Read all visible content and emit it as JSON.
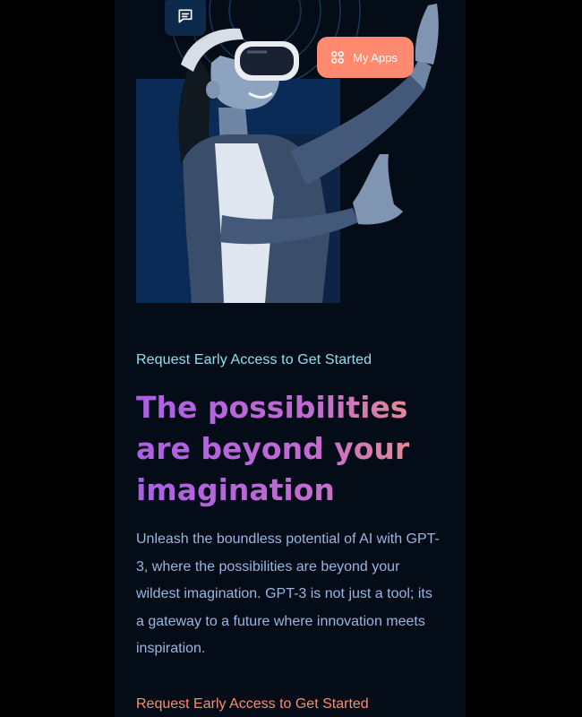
{
  "hero": {
    "chat_icon": "chat-icon",
    "apps_button": {
      "label": "My Apps",
      "icon": "grid-icon"
    }
  },
  "content": {
    "eyebrow": "Request Early Access to Get Started",
    "headline": "The possibilities are beyond your imagination",
    "description": "Unleash the boundless potential of AI with GPT-3, where the possibilities are beyond your wildest imagination. GPT-3 is not just a tool; its a gateway to a future where innovation meets inspiration.",
    "cta_label": "Request Early Access to Get Started"
  },
  "colors": {
    "page_bg": "#040c18",
    "accent_coral": "#ff8a6f",
    "eyebrow_cyan": "#8fe0ee",
    "gradient_start": "#ad5ee6",
    "gradient_end": "#f39a78",
    "body_text": "#9ab6df"
  }
}
